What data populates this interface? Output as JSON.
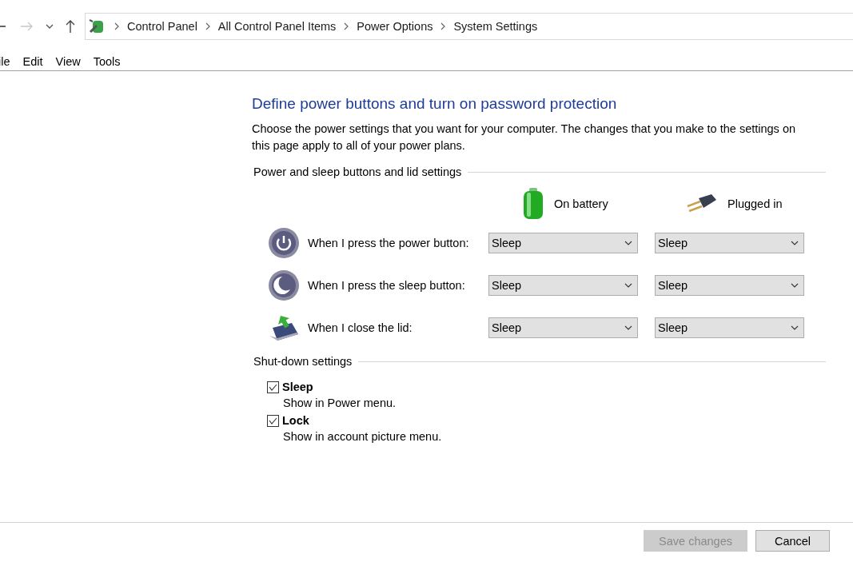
{
  "navigation": {
    "back_disabled": false,
    "forward_disabled": true
  },
  "breadcrumb": [
    "Control Panel",
    "All Control Panel Items",
    "Power Options",
    "System Settings"
  ],
  "menu": [
    "ile",
    "Edit",
    "View",
    "Tools"
  ],
  "heading": "Define power buttons and turn on password protection",
  "description": "Choose the power settings that you want for your computer. The changes that you make to the settings on this page apply to all of your power plans.",
  "buttons_section": {
    "title": "Power and sleep buttons and lid settings",
    "columns": [
      {
        "kind": "battery",
        "label": "On battery"
      },
      {
        "kind": "plug",
        "label": "Plugged in"
      }
    ],
    "rows": [
      {
        "kind": "power",
        "label": "When I press the power button:",
        "values": [
          "Sleep",
          "Sleep"
        ]
      },
      {
        "kind": "sleep",
        "label": "When I press the sleep button:",
        "values": [
          "Sleep",
          "Sleep"
        ]
      },
      {
        "kind": "lid",
        "label": "When I close the lid:",
        "values": [
          "Sleep",
          "Sleep"
        ]
      }
    ]
  },
  "shutdown_section": {
    "title": "Shut-down settings",
    "items": [
      {
        "label": "Sleep",
        "description": "Show in Power menu.",
        "checked": true
      },
      {
        "label": "Lock",
        "description": "Show in account picture menu.",
        "checked": true
      }
    ]
  },
  "footer_buttons": [
    {
      "label": "Save changes",
      "disabled": true
    },
    {
      "label": "Cancel",
      "disabled": false
    }
  ]
}
